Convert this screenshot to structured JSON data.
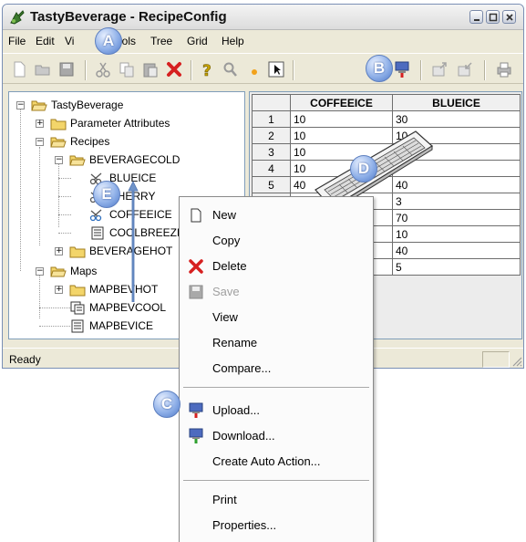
{
  "window": {
    "title": "TastyBeverage - RecipeConfig",
    "status": "Ready"
  },
  "menubar": [
    "File",
    "Edit",
    "Vi",
    "Tools",
    "Tree",
    "Grid",
    "Help"
  ],
  "toolbar_icons": [
    "new-icon",
    "open-icon",
    "save-icon",
    "cut-icon",
    "copy-icon",
    "paste-icon",
    "delete-icon",
    "help-icon",
    "find-icon",
    "dot-icon",
    "select-icon",
    "upload-icon",
    "export-icon",
    "import-icon",
    "print-icon"
  ],
  "tree": {
    "root": "TastyBeverage",
    "items": [
      {
        "label": "TastyBeverage",
        "icon": "folder-open-icon"
      },
      {
        "label": "Parameter Attributes",
        "icon": "folder-icon"
      },
      {
        "label": "Recipes",
        "icon": "folder-open-icon"
      },
      {
        "label": "BEVERAGECOLD",
        "icon": "folder-open-icon"
      },
      {
        "label": "BLUEICE",
        "icon": "recipe-scissor-icon"
      },
      {
        "label": "CHERRY",
        "icon": "recipe-scissor-icon"
      },
      {
        "label": "COFFEEICE",
        "icon": "recipe-scissor-icon"
      },
      {
        "label": "COOLBREEZE",
        "icon": "document-icon"
      },
      {
        "label": "BEVERAGEHOT",
        "icon": "folder-icon"
      },
      {
        "label": "Maps",
        "icon": "folder-open-icon"
      },
      {
        "label": "MAPBEVHOT",
        "icon": "folder-icon"
      },
      {
        "label": "MAPBEVCOOL",
        "icon": "map-icon"
      },
      {
        "label": "MAPBEVICE",
        "icon": "document-icon"
      }
    ]
  },
  "grid": {
    "columns": [
      "COFFEEICE",
      "BLUEICE"
    ],
    "rows": [
      {
        "n": "1",
        "c1": "10",
        "c2": "30"
      },
      {
        "n": "2",
        "c1": "10",
        "c2": "10"
      },
      {
        "n": "3",
        "c1": "10",
        "c2": ""
      },
      {
        "n": "4",
        "c1": "10",
        "c2": ""
      },
      {
        "n": "5",
        "c1": "40",
        "c2": "40"
      },
      {
        "n": "",
        "c1": "",
        "c2": "3"
      },
      {
        "n": "",
        "c1": "",
        "c2": "70"
      },
      {
        "n": "",
        "c1": "",
        "c2": "10"
      },
      {
        "n": "",
        "c1": "",
        "c2": "40"
      },
      {
        "n": "",
        "c1": "",
        "c2": "5"
      }
    ]
  },
  "context_menu": {
    "new": "New",
    "copy": "Copy",
    "delete": "Delete",
    "save": "Save",
    "view": "View",
    "rename": "Rename",
    "compare": "Compare...",
    "upload": "Upload...",
    "download": "Download...",
    "create_auto_action": "Create Auto Action...",
    "print": "Print",
    "properties": "Properties..."
  },
  "callouts": {
    "a": "A",
    "b": "B",
    "c": "C",
    "d": "D",
    "e": "E"
  },
  "colors": {
    "callout": "#8fb0e8",
    "window_bg": "#ece9d8",
    "delete_red": "#d62020",
    "folder_yellow": "#f3d56a"
  }
}
